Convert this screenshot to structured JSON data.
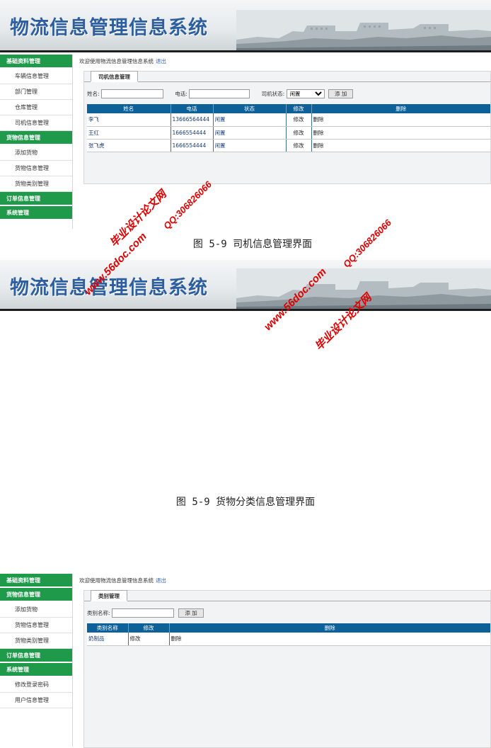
{
  "app": {
    "title": "物流信息管理信息系统"
  },
  "screens": [
    {
      "welcome": "欢迎使用物流信息管理信息系统",
      "logout": "退出",
      "sidebar": [
        {
          "type": "head",
          "label": "基础资料管理"
        },
        {
          "type": "item",
          "label": "车辆信息管理"
        },
        {
          "type": "item",
          "label": "部门管理"
        },
        {
          "type": "item",
          "label": "仓库管理"
        },
        {
          "type": "item",
          "label": "司机信息管理"
        },
        {
          "type": "head",
          "label": "货物信息管理"
        },
        {
          "type": "item",
          "label": "添加货物"
        },
        {
          "type": "item",
          "label": "货物信息管理"
        },
        {
          "type": "item",
          "label": "货物类别管理"
        },
        {
          "type": "head",
          "label": "订单信息管理"
        },
        {
          "type": "head",
          "label": "系统管理"
        }
      ],
      "tab": "司机信息管理",
      "search": {
        "name_label": "姓名:",
        "phone_label": "电话:",
        "status_label": "司机状态:",
        "status_value": "闲置",
        "add_button": "添 加"
      },
      "table": {
        "headers": [
          "姓名",
          "电话",
          "状态",
          "修改",
          "删除"
        ],
        "rows": [
          [
            "李飞",
            "13666564444",
            "闲置",
            "修改",
            "删除"
          ],
          [
            "王红",
            "1666554444",
            "闲置",
            "修改",
            "删除"
          ],
          [
            "张飞虎",
            "1666554444",
            "闲置",
            "修改",
            "删除"
          ]
        ]
      },
      "caption": "图 5-9 司机信息管理界面"
    },
    {
      "welcome": "欢迎使用物流信息管理信息系统",
      "logout": "退出",
      "sidebar": [
        {
          "type": "head",
          "label": "基础资料管理"
        },
        {
          "type": "head",
          "label": "货物信息管理"
        },
        {
          "type": "item",
          "label": "添加货物"
        },
        {
          "type": "item",
          "label": "货物信息管理"
        },
        {
          "type": "item",
          "label": "货物类别管理"
        },
        {
          "type": "head",
          "label": "订单信息管理"
        },
        {
          "type": "head",
          "label": "系统管理"
        },
        {
          "type": "item",
          "label": "修改登录密码"
        },
        {
          "type": "item",
          "label": "用户信息管理"
        }
      ],
      "tab": "类别管理",
      "search": {
        "name_label": "类别名称:",
        "add_button": "添 加"
      },
      "table": {
        "headers": [
          "类别名称",
          "修改",
          "删除"
        ],
        "rows": [
          [
            "奶制品",
            "修改",
            "删除"
          ]
        ]
      },
      "caption": "图 5-9 货物分类信息管理界面"
    }
  ],
  "watermark": {
    "site": "www.56doc.com",
    "brand": "毕业设计论文网",
    "qq": "QQ:306826066"
  },
  "colors": {
    "sidebar_head": "#1f9a4b",
    "table_header": "#0e6198",
    "banner_title": "#2d5fa0",
    "watermark": "#e00000"
  }
}
